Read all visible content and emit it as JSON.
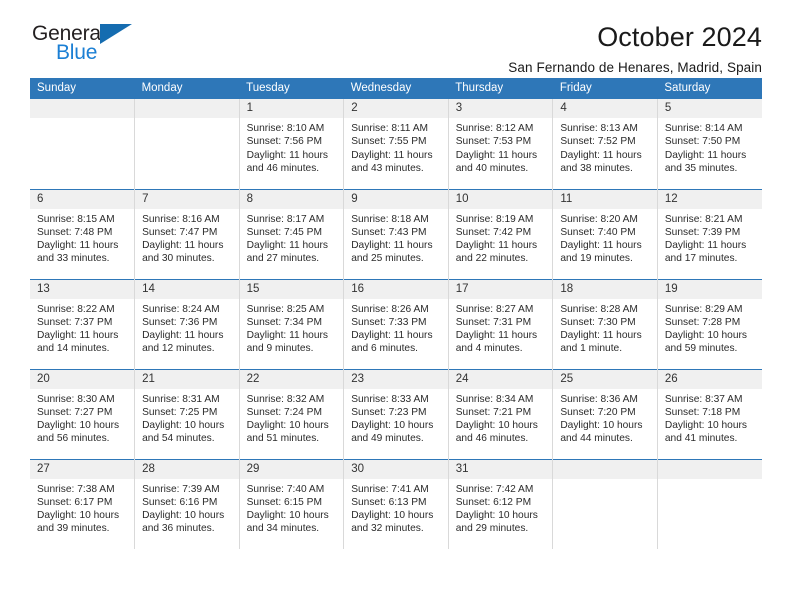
{
  "brand": {
    "name_part1": "General",
    "name_part2": "Blue",
    "accent_color": "#1b7fd4",
    "triangle_color": "#156cb0"
  },
  "header": {
    "title": "October 2024",
    "subtitle": "San Fernando de Henares, Madrid, Spain"
  },
  "calendar": {
    "header_color": "#2e77b8",
    "weekday_headers": [
      "Sunday",
      "Monday",
      "Tuesday",
      "Wednesday",
      "Thursday",
      "Friday",
      "Saturday"
    ],
    "weeks": [
      [
        {
          "day": "",
          "lines": ""
        },
        {
          "day": "",
          "lines": ""
        },
        {
          "day": "1",
          "lines": "Sunrise: 8:10 AM\nSunset: 7:56 PM\nDaylight: 11 hours\nand 46 minutes."
        },
        {
          "day": "2",
          "lines": "Sunrise: 8:11 AM\nSunset: 7:55 PM\nDaylight: 11 hours\nand 43 minutes."
        },
        {
          "day": "3",
          "lines": "Sunrise: 8:12 AM\nSunset: 7:53 PM\nDaylight: 11 hours\nand 40 minutes."
        },
        {
          "day": "4",
          "lines": "Sunrise: 8:13 AM\nSunset: 7:52 PM\nDaylight: 11 hours\nand 38 minutes."
        },
        {
          "day": "5",
          "lines": "Sunrise: 8:14 AM\nSunset: 7:50 PM\nDaylight: 11 hours\nand 35 minutes."
        }
      ],
      [
        {
          "day": "6",
          "lines": "Sunrise: 8:15 AM\nSunset: 7:48 PM\nDaylight: 11 hours\nand 33 minutes."
        },
        {
          "day": "7",
          "lines": "Sunrise: 8:16 AM\nSunset: 7:47 PM\nDaylight: 11 hours\nand 30 minutes."
        },
        {
          "day": "8",
          "lines": "Sunrise: 8:17 AM\nSunset: 7:45 PM\nDaylight: 11 hours\nand 27 minutes."
        },
        {
          "day": "9",
          "lines": "Sunrise: 8:18 AM\nSunset: 7:43 PM\nDaylight: 11 hours\nand 25 minutes."
        },
        {
          "day": "10",
          "lines": "Sunrise: 8:19 AM\nSunset: 7:42 PM\nDaylight: 11 hours\nand 22 minutes."
        },
        {
          "day": "11",
          "lines": "Sunrise: 8:20 AM\nSunset: 7:40 PM\nDaylight: 11 hours\nand 19 minutes."
        },
        {
          "day": "12",
          "lines": "Sunrise: 8:21 AM\nSunset: 7:39 PM\nDaylight: 11 hours\nand 17 minutes."
        }
      ],
      [
        {
          "day": "13",
          "lines": "Sunrise: 8:22 AM\nSunset: 7:37 PM\nDaylight: 11 hours\nand 14 minutes."
        },
        {
          "day": "14",
          "lines": "Sunrise: 8:24 AM\nSunset: 7:36 PM\nDaylight: 11 hours\nand 12 minutes."
        },
        {
          "day": "15",
          "lines": "Sunrise: 8:25 AM\nSunset: 7:34 PM\nDaylight: 11 hours\nand 9 minutes."
        },
        {
          "day": "16",
          "lines": "Sunrise: 8:26 AM\nSunset: 7:33 PM\nDaylight: 11 hours\nand 6 minutes."
        },
        {
          "day": "17",
          "lines": "Sunrise: 8:27 AM\nSunset: 7:31 PM\nDaylight: 11 hours\nand 4 minutes."
        },
        {
          "day": "18",
          "lines": "Sunrise: 8:28 AM\nSunset: 7:30 PM\nDaylight: 11 hours\nand 1 minute."
        },
        {
          "day": "19",
          "lines": "Sunrise: 8:29 AM\nSunset: 7:28 PM\nDaylight: 10 hours\nand 59 minutes."
        }
      ],
      [
        {
          "day": "20",
          "lines": "Sunrise: 8:30 AM\nSunset: 7:27 PM\nDaylight: 10 hours\nand 56 minutes."
        },
        {
          "day": "21",
          "lines": "Sunrise: 8:31 AM\nSunset: 7:25 PM\nDaylight: 10 hours\nand 54 minutes."
        },
        {
          "day": "22",
          "lines": "Sunrise: 8:32 AM\nSunset: 7:24 PM\nDaylight: 10 hours\nand 51 minutes."
        },
        {
          "day": "23",
          "lines": "Sunrise: 8:33 AM\nSunset: 7:23 PM\nDaylight: 10 hours\nand 49 minutes."
        },
        {
          "day": "24",
          "lines": "Sunrise: 8:34 AM\nSunset: 7:21 PM\nDaylight: 10 hours\nand 46 minutes."
        },
        {
          "day": "25",
          "lines": "Sunrise: 8:36 AM\nSunset: 7:20 PM\nDaylight: 10 hours\nand 44 minutes."
        },
        {
          "day": "26",
          "lines": "Sunrise: 8:37 AM\nSunset: 7:18 PM\nDaylight: 10 hours\nand 41 minutes."
        }
      ],
      [
        {
          "day": "27",
          "lines": "Sunrise: 7:38 AM\nSunset: 6:17 PM\nDaylight: 10 hours\nand 39 minutes."
        },
        {
          "day": "28",
          "lines": "Sunrise: 7:39 AM\nSunset: 6:16 PM\nDaylight: 10 hours\nand 36 minutes."
        },
        {
          "day": "29",
          "lines": "Sunrise: 7:40 AM\nSunset: 6:15 PM\nDaylight: 10 hours\nand 34 minutes."
        },
        {
          "day": "30",
          "lines": "Sunrise: 7:41 AM\nSunset: 6:13 PM\nDaylight: 10 hours\nand 32 minutes."
        },
        {
          "day": "31",
          "lines": "Sunrise: 7:42 AM\nSunset: 6:12 PM\nDaylight: 10 hours\nand 29 minutes."
        },
        {
          "day": "",
          "lines": ""
        },
        {
          "day": "",
          "lines": ""
        }
      ]
    ]
  }
}
